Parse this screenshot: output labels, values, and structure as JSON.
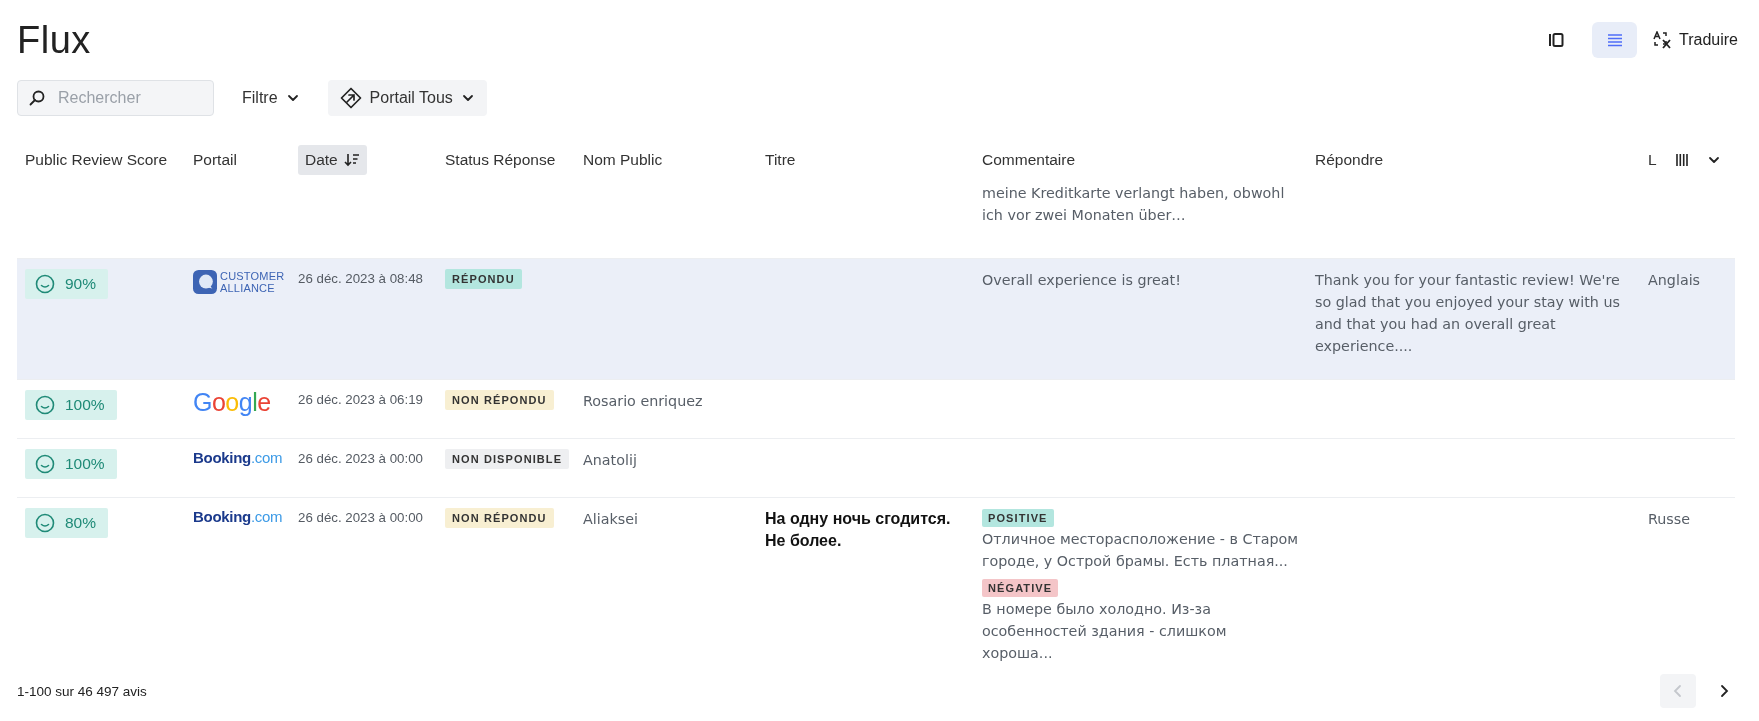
{
  "title": "Flux",
  "view_buttons": [
    {
      "kind": "columns",
      "selected": false
    },
    {
      "kind": "list",
      "selected": true
    }
  ],
  "translate_button": {
    "label": "Traduire"
  },
  "search": {
    "placeholder": "Rechercher"
  },
  "filter_button": {
    "label": "Filtre"
  },
  "portal_button": {
    "label": "Portail Tous"
  },
  "table": {
    "columns": [
      {
        "label": "Public Review Score",
        "sorted": false
      },
      {
        "label": "Portail",
        "sorted": false
      },
      {
        "label": "Date",
        "sorted": true
      },
      {
        "label": "Status Réponse",
        "sorted": false
      },
      {
        "label": "Nom Public",
        "sorted": false
      },
      {
        "label": "Titre",
        "sorted": false
      },
      {
        "label": "Commentaire",
        "sorted": false
      },
      {
        "label": "Répondre",
        "sorted": false
      },
      {
        "label": "L",
        "sorted": false
      }
    ],
    "rows": [
      {
        "selected": false,
        "comments": [
          {
            "text": "meine Kreditkarte verlangt haben, obwohl ich vor zwei Monaten über…"
          }
        ]
      },
      {
        "selected": true,
        "score": "90%",
        "portal": {
          "kind": "customer_alliance",
          "label": "CUSTOMER ALLIANCE"
        },
        "date": "26 déc. 2023 à 08:48",
        "status": {
          "kind": "answered",
          "label": "RÉPONDU"
        },
        "comments": [
          {
            "text": "Overall experience is great!"
          }
        ],
        "reply": "Thank you for your fantastic review! We're so glad that you enjoyed your stay with us and that you had an overall great experience....",
        "language": "Anglais"
      },
      {
        "selected": false,
        "score": "100%",
        "portal": {
          "kind": "google",
          "label": "Google"
        },
        "date": "26 déc. 2023 à 06:19",
        "status": {
          "kind": "unanswered",
          "label": "NON RÉPONDU"
        },
        "name": "Rosario enriquez"
      },
      {
        "selected": false,
        "score": "100%",
        "portal": {
          "kind": "booking",
          "label": "Booking.com"
        },
        "date": "26 déc. 2023 à 00:00",
        "status": {
          "kind": "unavailable",
          "label": "NON DISPONIBLE"
        },
        "name": "Anatolij"
      },
      {
        "selected": false,
        "score": "80%",
        "portal": {
          "kind": "booking",
          "label": "Booking.com"
        },
        "date": "26 déc. 2023 à 00:00",
        "status": {
          "kind": "unanswered",
          "label": "NON RÉPONDU"
        },
        "name": "Aliaksei",
        "title": "На одну ночь сгодится. Не более.",
        "comments": [
          {
            "tag": {
              "kind": "positive",
              "label": "POSITIVE"
            },
            "text": "Отличное месторасположение - в Старом городе, у Острой брамы. Есть платная..."
          },
          {
            "tag": {
              "kind": "negative",
              "label": "NÉGATIVE"
            },
            "text": "В номере было холодно. Из-за особенностей здания - слишком хороша..."
          }
        ],
        "language": "Russe"
      }
    ]
  },
  "footer": {
    "count": "1-100 sur 46 497 avis",
    "prev_button": {
      "disabled": true
    },
    "next_button": {
      "disabled": false
    }
  }
}
